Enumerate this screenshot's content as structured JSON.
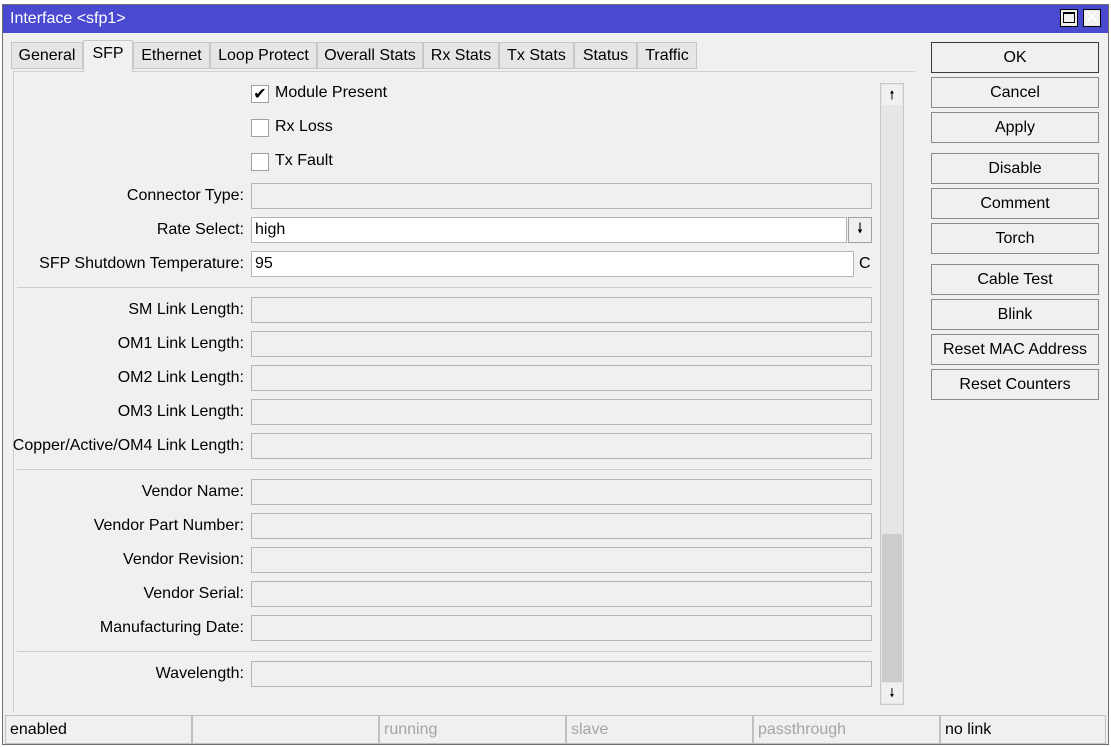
{
  "window": {
    "title": "Interface <sfp1>"
  },
  "tabs": [
    {
      "label": "General"
    },
    {
      "label": "SFP"
    },
    {
      "label": "Ethernet"
    },
    {
      "label": "Loop Protect"
    },
    {
      "label": "Overall Stats"
    },
    {
      "label": "Rx Stats"
    },
    {
      "label": "Tx Stats"
    },
    {
      "label": "Status"
    },
    {
      "label": "Traffic"
    }
  ],
  "active_tab": "SFP",
  "checkboxes": [
    {
      "label": "Module Present",
      "checked": true
    },
    {
      "label": "Rx Loss",
      "checked": false
    },
    {
      "label": "Tx Fault",
      "checked": false
    }
  ],
  "fields": {
    "connector_type": {
      "label": "Connector Type:",
      "value": ""
    },
    "rate_select": {
      "label": "Rate Select:",
      "value": "high"
    },
    "shutdown_temp": {
      "label": "SFP Shutdown Temperature:",
      "value": "95",
      "unit": "C"
    },
    "sm_link": {
      "label": "SM Link Length:",
      "value": ""
    },
    "om1_link": {
      "label": "OM1 Link Length:",
      "value": ""
    },
    "om2_link": {
      "label": "OM2 Link Length:",
      "value": ""
    },
    "om3_link": {
      "label": "OM3 Link Length:",
      "value": ""
    },
    "copper_link": {
      "label": "Copper/Active/OM4 Link Length:",
      "value": ""
    },
    "vendor_name": {
      "label": "Vendor Name:",
      "value": ""
    },
    "vendor_part": {
      "label": "Vendor Part Number:",
      "value": ""
    },
    "vendor_rev": {
      "label": "Vendor Revision:",
      "value": ""
    },
    "vendor_serial": {
      "label": "Vendor Serial:",
      "value": ""
    },
    "mfg_date": {
      "label": "Manufacturing Date:",
      "value": ""
    },
    "wavelength": {
      "label": "Wavelength:",
      "value": ""
    }
  },
  "buttons": {
    "ok": "OK",
    "cancel": "Cancel",
    "apply": "Apply",
    "disable": "Disable",
    "comment": "Comment",
    "torch": "Torch",
    "cable_test": "Cable Test",
    "blink": "Blink",
    "reset_mac": "Reset MAC Address",
    "reset_counters": "Reset Counters"
  },
  "status_bar": [
    "enabled",
    "",
    "running",
    "slave",
    "passthrough",
    "no link"
  ],
  "icons": {
    "maximize": "maximize-icon",
    "close": "close-icon",
    "dropdown": "dropdown-arrow-icon",
    "scroll_up": "scroll-up-icon",
    "scroll_down": "scroll-down-icon",
    "check": "checkmark-icon"
  },
  "colors": {
    "titlebar": "#4a4ad0",
    "background": "#f0f0f0",
    "dim_text": "#a5a5a5"
  }
}
